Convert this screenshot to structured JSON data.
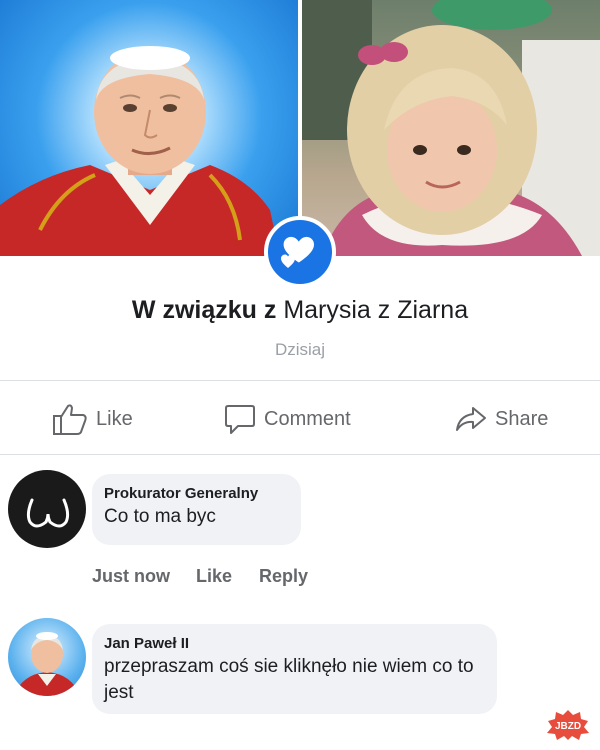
{
  "post": {
    "relationship_prefix": "W związku z",
    "partner_name": "Marysia z Ziarna",
    "date": "Dzisiaj"
  },
  "actions": {
    "like": "Like",
    "comment": "Comment",
    "share": "Share"
  },
  "comments": [
    {
      "author": "Prokurator Generalny",
      "text": "Co to ma byc",
      "time": "Just now",
      "like": "Like",
      "reply": "Reply"
    },
    {
      "author": "Jan Paweł II",
      "text": "przepraszam coś sie kliknęło nie wiem co to jest"
    }
  ],
  "watermark": "JBZD",
  "colors": {
    "accent_blue": "#1b74e4",
    "text_primary": "#1c1e21",
    "text_secondary": "#65676b",
    "bubble_bg": "#f0f2f5",
    "divider": "#dcdfe3",
    "watermark_red": "#e74c3c"
  }
}
